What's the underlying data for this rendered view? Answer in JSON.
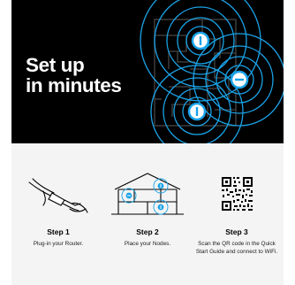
{
  "hero": {
    "title_line1": "Set up",
    "title_line2": "in minutes",
    "background": "#000000",
    "accent": "#1aa3e8"
  },
  "steps": [
    {
      "title": "Step 1",
      "description": "Plug-in your Router.",
      "illustration": "plug-icon"
    },
    {
      "title": "Step 2",
      "description": "Place your Nodes.",
      "illustration": "house-icon"
    },
    {
      "title": "Step 3",
      "description": "Scan the QR code in the Quick Start Guide and connect to WiFi.",
      "illustration": "qr-code-icon"
    }
  ],
  "colors": {
    "lower_background": "#f4f4f4",
    "text": "#000000",
    "accent_blue": "#1aa3e8"
  }
}
